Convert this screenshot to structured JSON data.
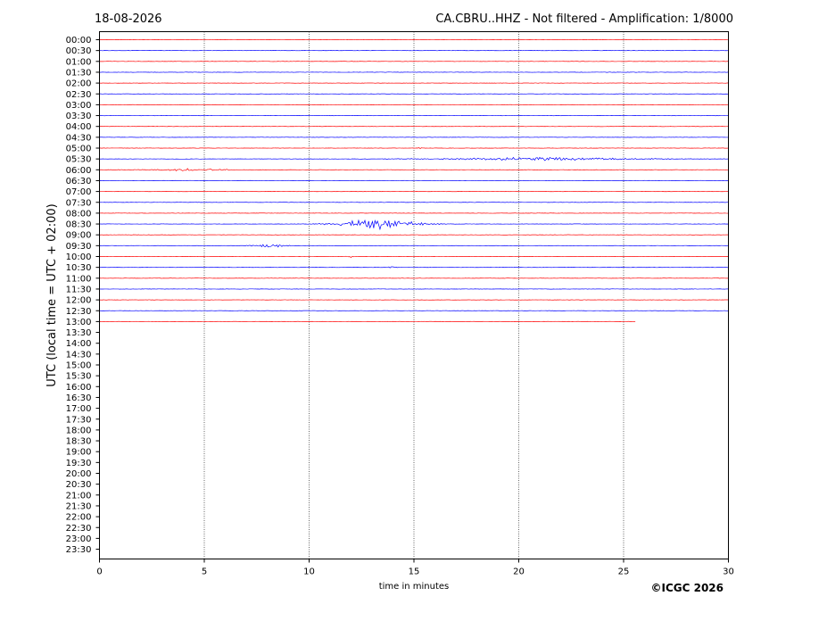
{
  "header": {
    "date": "18-08-2026",
    "title": "CA.CBRU..HHZ - Not filtered - Amplification: 1/8000"
  },
  "copyright": "©ICGC 2026",
  "chart_data": {
    "type": "line",
    "title": "CA.CBRU..HHZ - Not filtered - Amplification: 1/8000",
    "xlabel": "time in minutes",
    "ylabel": "UTC (local time = UTC + 02:00)",
    "xlim": [
      0,
      30
    ],
    "x_ticks": [
      "0",
      "5",
      "10",
      "15",
      "20",
      "25",
      "30"
    ],
    "grid_x": true,
    "row_labels": [
      "00:00",
      "00:30",
      "01:00",
      "01:30",
      "02:00",
      "02:30",
      "03:00",
      "03:30",
      "04:00",
      "04:30",
      "05:00",
      "05:30",
      "06:00",
      "06:30",
      "07:00",
      "07:30",
      "08:00",
      "08:30",
      "09:00",
      "09:30",
      "10:00",
      "10:30",
      "11:00",
      "11:30",
      "12:00",
      "12:30",
      "13:00",
      "13:30",
      "14:00",
      "14:30",
      "15:00",
      "15:30",
      "16:00",
      "16:30",
      "17:00",
      "17:30",
      "18:00",
      "18:30",
      "19:00",
      "19:30",
      "20:00",
      "20:30",
      "21:00",
      "21:30",
      "22:00",
      "22:30",
      "23:00",
      "23:30"
    ],
    "trace_colors": [
      "#ff0000",
      "#0000ff"
    ],
    "traces_end": {
      "row": "13:00",
      "minute": 25.6
    },
    "events": [
      {
        "row": "05:00",
        "start": 15.0,
        "end": 15.5,
        "amplitude": 0.2
      },
      {
        "row": "05:30",
        "start": 12.0,
        "end": 30.0,
        "amplitude": 0.35
      },
      {
        "row": "06:00",
        "start": 0.0,
        "end": 8.5,
        "amplitude": 0.25
      },
      {
        "row": "08:30",
        "start": 9.5,
        "end": 17.0,
        "amplitude": 1.0
      },
      {
        "row": "09:30",
        "start": 6.2,
        "end": 10.2,
        "amplitude": 0.3
      },
      {
        "row": "10:00",
        "start": 11.6,
        "end": 12.3,
        "amplitude": 0.25
      },
      {
        "row": "10:30",
        "start": 13.5,
        "end": 14.5,
        "amplitude": 0.2
      }
    ]
  }
}
